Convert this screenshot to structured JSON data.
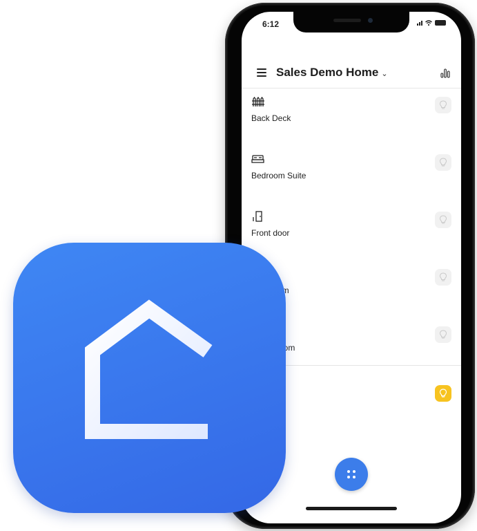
{
  "status_bar": {
    "time": "6:12"
  },
  "header": {
    "home_name": "Sales Demo Home",
    "chevron": "⌄",
    "menu_icon": "hamburger-menu-icon",
    "energy_icon": "bar-chart-icon"
  },
  "rooms": [
    {
      "name": "Back Deck",
      "icon": "fence-icon",
      "light_on": false
    },
    {
      "name": "Bedroom Suite",
      "icon": "bed-icon",
      "light_on": false
    },
    {
      "name": "Front door",
      "icon": "door-icon",
      "light_on": false
    },
    {
      "name": "om",
      "icon": "room-icon",
      "light_on": false
    },
    {
      "name": "oom",
      "icon": "room-icon",
      "light_on": false
    }
  ],
  "fab_icon": "grid-dots-icon",
  "app_icon": {
    "symbol": "house-outline-icon"
  },
  "colors": {
    "accent_blue": "#3c7dea",
    "light_on_yellow": "#f7c320",
    "icon_gradient_start": "#3f87f4",
    "icon_gradient_end": "#3468e6"
  }
}
